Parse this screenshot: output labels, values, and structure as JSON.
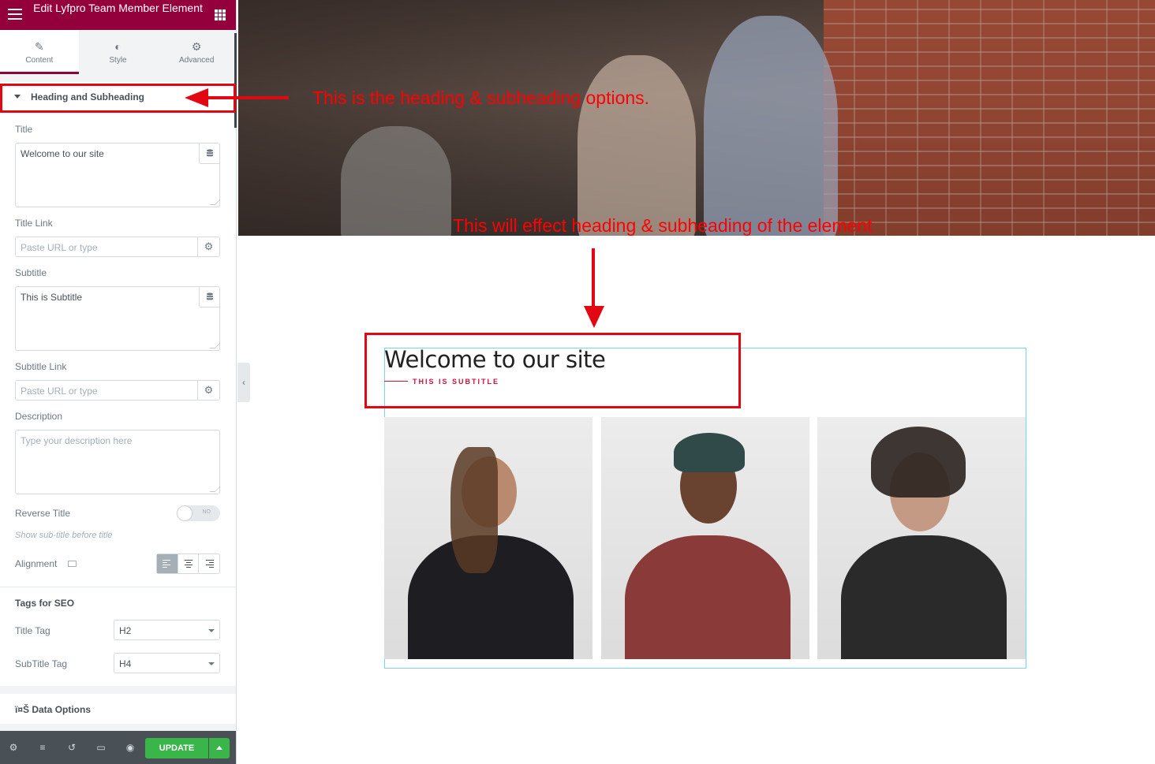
{
  "panel": {
    "title": "Edit Lyfpro Team Member Element",
    "tabs": [
      {
        "label": "Content",
        "icon": "pencil-icon",
        "active": true
      },
      {
        "label": "Style",
        "icon": "contrast-icon",
        "active": false
      },
      {
        "label": "Advanced",
        "icon": "gear-icon",
        "active": false
      }
    ],
    "section_title": "Heading and Subheading",
    "fields": {
      "title_label": "Title",
      "title_value": "Welcome to our site",
      "title_link_label": "Title Link",
      "title_link_placeholder": "Paste URL or type",
      "subtitle_label": "Subtitle",
      "subtitle_value": "This is Subtitle",
      "subtitle_link_label": "Subtitle Link",
      "subtitle_link_placeholder": "Paste URL or type",
      "description_label": "Description",
      "description_placeholder": "Type your description here",
      "reverse_title_label": "Reverse Title",
      "reverse_toggle_text": "NO",
      "reverse_hint": "Show sub-title before title",
      "alignment_label": "Alignment"
    },
    "seo": {
      "heading": "Tags for SEO",
      "title_tag_label": "Title Tag",
      "title_tag_value": "H2",
      "subtitle_tag_label": "SubTitle Tag",
      "subtitle_tag_value": "H4"
    },
    "data_options": "ï¤Š Data Options",
    "update_label": "UPDATE",
    "colors": {
      "brand": "#93003c",
      "update": "#39b54a"
    }
  },
  "annotations": {
    "top": "This is the heading & subheading options.",
    "middle": "This will effect heading & subheading of the element"
  },
  "preview": {
    "title": "Welcome to our site",
    "subtitle": "THIS IS SUBTITLE"
  }
}
